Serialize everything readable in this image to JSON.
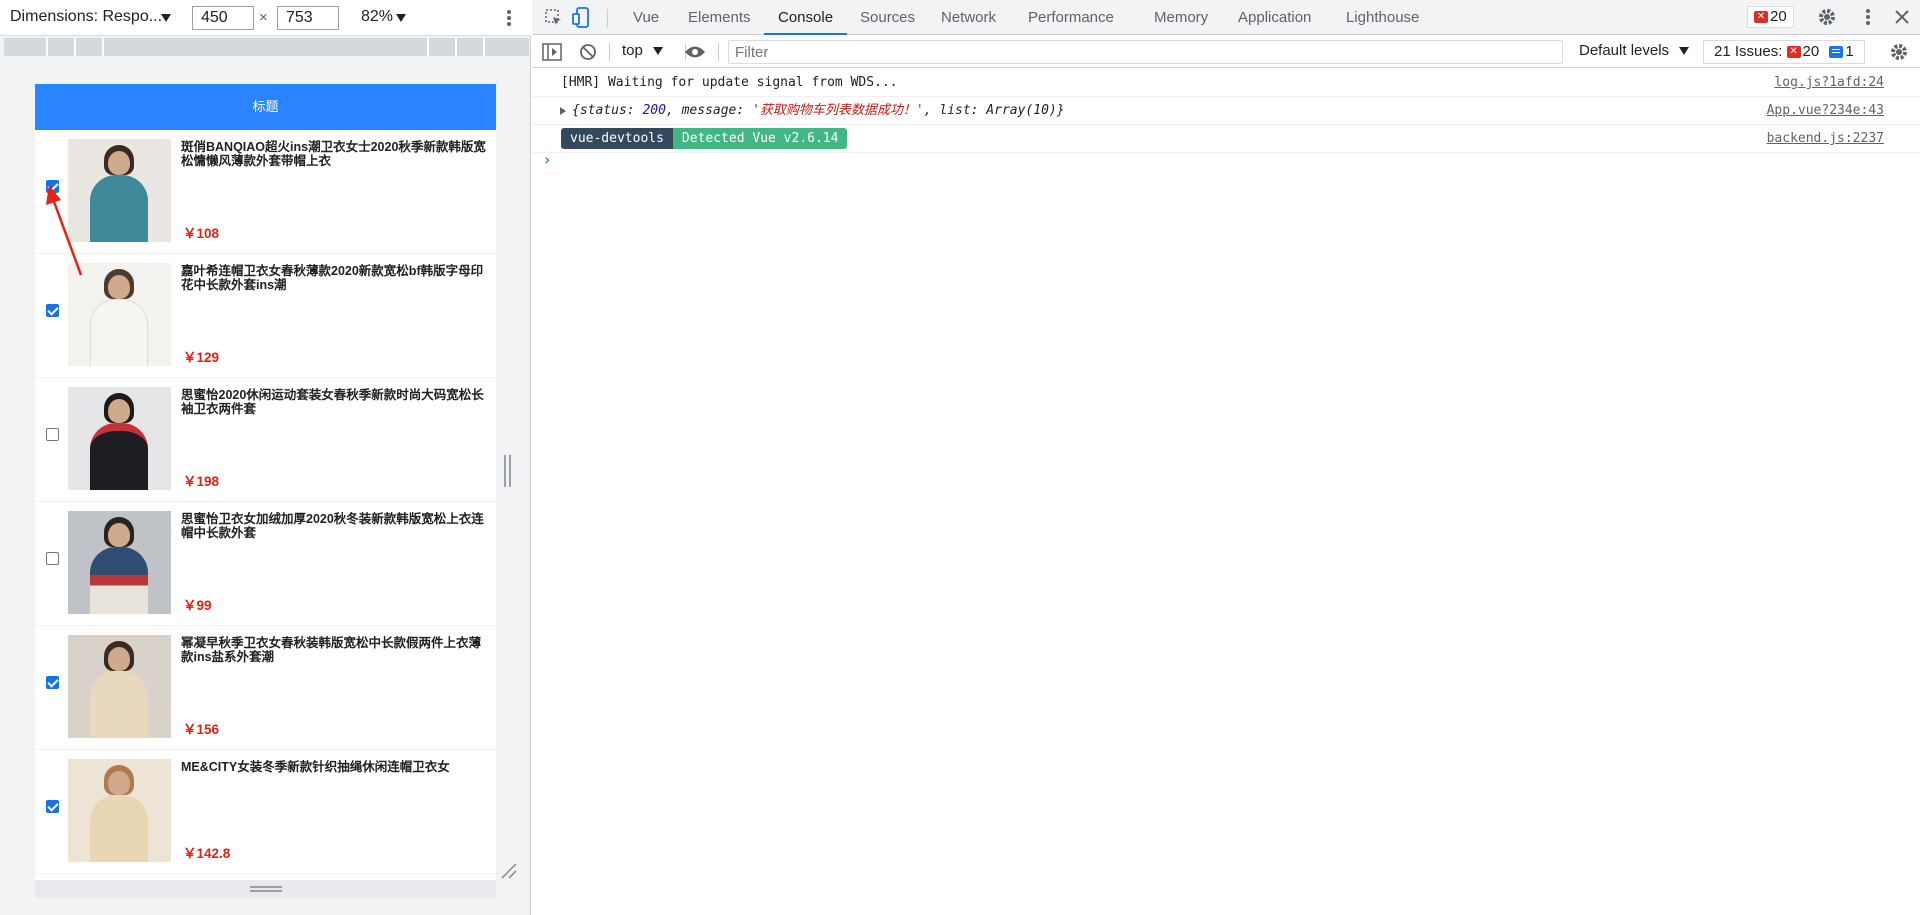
{
  "device_toolbar": {
    "dimensions_label": "Dimensions: Respo...",
    "width_value": "450",
    "height_value": "753",
    "times_symbol": "×",
    "zoom_label": "82%"
  },
  "app": {
    "nav_title": "标题",
    "items": [
      {
        "title": "斑俏BANQIAO超火ins潮卫衣女士2020秋季新款韩版宽松慵懒风薄款外套带帽上衣",
        "price": "￥108",
        "checked": true
      },
      {
        "title": "嘉叶希连帽卫衣女春秋薄款2020新款宽松bf韩版字母印花中长款外套ins潮",
        "price": "￥129",
        "checked": true
      },
      {
        "title": "思蜜怡2020休闲运动套装女春秋季新款时尚大码宽松长袖卫衣两件套",
        "price": "￥198",
        "checked": false
      },
      {
        "title": "思蜜怡卫衣女加绒加厚2020秋冬装新款韩版宽松上衣连帽中长款外套",
        "price": "￥99",
        "checked": false
      },
      {
        "title": "幂凝早秋季卫衣女春秋装韩版宽松中长款假两件上衣薄款ins盐系外套潮",
        "price": "￥156",
        "checked": true
      },
      {
        "title": "ME&CITY女装冬季新款针织抽绳休闲连帽卫衣女",
        "price": "￥142.8",
        "checked": true
      }
    ]
  },
  "devtools": {
    "tabs": [
      "Vue",
      "Elements",
      "Console",
      "Sources",
      "Network",
      "Performance",
      "Memory",
      "Application",
      "Lighthouse"
    ],
    "active_tab": "Console",
    "error_count": "20",
    "context": "top",
    "filter_placeholder": "Filter",
    "levels": "Default levels",
    "issues_label": "21 Issues:",
    "issues_errors": "20",
    "issues_info": "1"
  },
  "console": {
    "messages": [
      {
        "text": "[HMR] Waiting for update signal from WDS...",
        "source": "log.js?1afd:24"
      },
      {
        "prefix": "{status: ",
        "status": "200",
        "mid": ", message: ",
        "message": "'获取购物车列表数据成功！'",
        "suffix": ", list: Array(10)}",
        "source": "App.vue?234e:43"
      },
      {
        "pill1": "vue-devtools",
        "pill2": "Detected Vue v2.6.14",
        "source": "backend.js:2237"
      }
    ],
    "prompt": "›"
  }
}
